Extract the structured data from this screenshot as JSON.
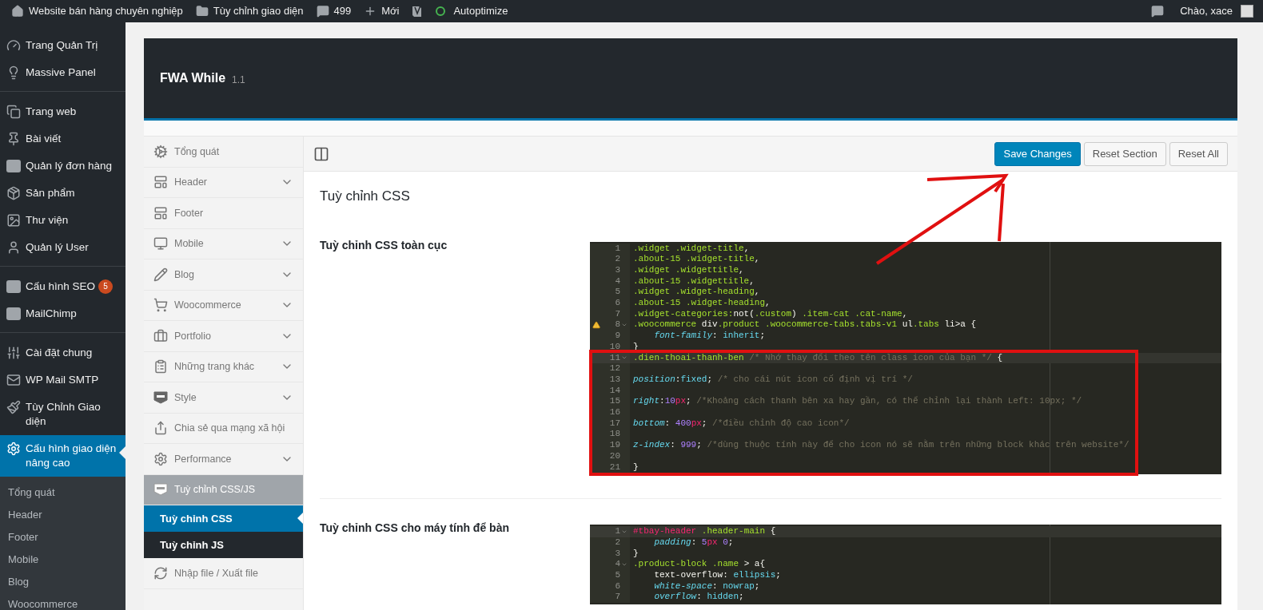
{
  "admin_bar": {
    "items": [
      {
        "label": "Website bán hàng chuyên nghiệp"
      },
      {
        "label": "Tùy chỉnh giao diện"
      },
      {
        "label": "499"
      },
      {
        "label": "Mới"
      },
      {
        "label": "Autoptimize"
      }
    ],
    "greeting": "Chào, xace"
  },
  "sidebar": {
    "groups": [
      {
        "items": [
          {
            "label": "Trang Quản Trị",
            "selected": false
          },
          {
            "label": "Massive Panel",
            "selected": false
          }
        ]
      },
      {
        "items": [
          {
            "label": "Trang web",
            "selected": false
          },
          {
            "label": "Bài viết",
            "selected": false
          },
          {
            "label": "Quản lý đơn hàng",
            "selected": false
          },
          {
            "label": "Sản phẩm",
            "selected": false
          },
          {
            "label": "Thư viện",
            "selected": false
          },
          {
            "label": "Quản lý User",
            "selected": false
          }
        ]
      },
      {
        "items": [
          {
            "label": "Cấu hình SEO",
            "selected": false,
            "badge": "5"
          },
          {
            "label": "MailChimp",
            "selected": false
          }
        ]
      },
      {
        "items": [
          {
            "label": "Cài đặt chung",
            "selected": false
          },
          {
            "label": "WP Mail SMTP",
            "selected": false
          },
          {
            "label": "Tùy Chỉnh Giao diện",
            "selected": false
          },
          {
            "label": "Cấu hình giao diện nâng cao",
            "selected": true
          }
        ]
      }
    ],
    "submenu": [
      "Tổng quát",
      "Header",
      "Footer",
      "Mobile",
      "Blog",
      "Woocommerce"
    ]
  },
  "panel": {
    "title": "FWA While",
    "version": "1.1",
    "nav": [
      {
        "label": "Tổng quát",
        "collapsible": false
      },
      {
        "label": "Header",
        "collapsible": true
      },
      {
        "label": "Footer",
        "collapsible": false
      },
      {
        "label": "Mobile",
        "collapsible": true
      },
      {
        "label": "Blog",
        "collapsible": true
      },
      {
        "label": "Woocommerce",
        "collapsible": true
      },
      {
        "label": "Portfolio",
        "collapsible": true
      },
      {
        "label": "Những trang khác",
        "collapsible": true
      },
      {
        "label": "Style",
        "collapsible": true
      },
      {
        "label": "Chia sẻ qua mạng xã hội",
        "collapsible": false
      },
      {
        "label": "Performance",
        "collapsible": true
      },
      {
        "label": "Tuỳ chỉnh CSS/JS",
        "collapsible": false,
        "expanded": true,
        "children": [
          {
            "label": "Tuỳ chỉnh CSS",
            "selected": true
          },
          {
            "label": "Tuỳ chỉnh JS",
            "selected": false
          }
        ]
      },
      {
        "label": "Nhập file / Xuất file",
        "collapsible": false
      }
    ],
    "buttons": [
      {
        "label": "Save Changes",
        "kind": "primary"
      },
      {
        "label": "Reset Section",
        "kind": "secondary"
      },
      {
        "label": "Reset All",
        "kind": "secondary"
      }
    ],
    "section_title": "Tuỳ chỉnh CSS",
    "fields": [
      {
        "label": "Tuỳ chỉnh CSS toàn cục",
        "editor": {
          "lines": [
            {
              "n": "1",
              "tokens": [
                {
                  "t": ".widget .widget-title",
                  "kind": "sel"
                },
                {
                  "t": ",",
                  "kind": "p"
                }
              ]
            },
            {
              "n": "2",
              "tokens": [
                {
                  "t": ".about-15 .widget-title",
                  "kind": "sel"
                },
                {
                  "t": ",",
                  "kind": "p"
                }
              ]
            },
            {
              "n": "3",
              "tokens": [
                {
                  "t": ".widget .widgettitle",
                  "kind": "sel"
                },
                {
                  "t": ",",
                  "kind": "p"
                }
              ]
            },
            {
              "n": "4",
              "tokens": [
                {
                  "t": ".about-15 .widgettitle",
                  "kind": "sel"
                },
                {
                  "t": ",",
                  "kind": "p"
                }
              ]
            },
            {
              "n": "5",
              "tokens": [
                {
                  "t": ".widget .widget-heading",
                  "kind": "sel"
                },
                {
                  "t": ",",
                  "kind": "p"
                }
              ]
            },
            {
              "n": "6",
              "tokens": [
                {
                  "t": ".about-15 .widget-heading",
                  "kind": "sel"
                },
                {
                  "t": ",",
                  "kind": "p"
                }
              ]
            },
            {
              "n": "7",
              "tokens": [
                {
                  "t": ".widget-categories:",
                  "kind": "sel"
                },
                {
                  "t": "not(",
                  "kind": "p"
                },
                {
                  "t": ".custom",
                  "kind": "sel"
                },
                {
                  "t": ") ",
                  "kind": "p"
                },
                {
                  "t": ".item-cat .cat-name",
                  "kind": "sel"
                },
                {
                  "t": ",",
                  "kind": "p"
                }
              ]
            },
            {
              "n": "8",
              "warning": true,
              "fold": true,
              "tokens": [
                {
                  "t": ".woocommerce",
                  "kind": "sel"
                },
                {
                  "t": " div",
                  "kind": "p"
                },
                {
                  "t": ".product .woocommerce-tabs.tabs-v1",
                  "kind": "sel"
                },
                {
                  "t": " ul",
                  "kind": "p"
                },
                {
                  "t": ".tabs",
                  "kind": "sel"
                },
                {
                  "t": " li>a {",
                  "kind": "p"
                }
              ]
            },
            {
              "n": "9",
              "tokens": [
                {
                  "t": "    font-family",
                  "kind": "prop"
                },
                {
                  "t": ": ",
                  "kind": "p"
                },
                {
                  "t": "inherit",
                  "kind": "val"
                },
                {
                  "t": ";",
                  "kind": "p"
                }
              ]
            },
            {
              "n": "10",
              "tokens": [
                {
                  "t": "}",
                  "kind": "p"
                }
              ]
            },
            {
              "n": "11",
              "fold": true,
              "active": true,
              "tokens": [
                {
                  "t": ".dien-thoai-thanh-ben",
                  "kind": "sel"
                },
                {
                  "t": " /* Nhớ thay đổi theo tên class icon của bạn */",
                  "kind": "com"
                },
                {
                  "t": " {",
                  "kind": "p"
                }
              ]
            },
            {
              "n": "12"
            },
            {
              "n": "13",
              "tokens": [
                {
                  "t": "position",
                  "kind": "prop"
                },
                {
                  "t": ":",
                  "kind": "p"
                },
                {
                  "t": "fixed",
                  "kind": "val"
                },
                {
                  "t": ";",
                  "kind": "p"
                },
                {
                  "t": " /* cho cái nút icon cố định vị trí */",
                  "kind": "com"
                }
              ]
            },
            {
              "n": "14"
            },
            {
              "n": "15",
              "tokens": [
                {
                  "t": "right",
                  "kind": "prop"
                },
                {
                  "t": ":",
                  "kind": "p"
                },
                {
                  "t": "10",
                  "kind": "num"
                },
                {
                  "t": "px",
                  "kind": "unit"
                },
                {
                  "t": ";",
                  "kind": "p"
                },
                {
                  "t": " /*Khoảng cách thanh bên xa hay gần, có thể chỉnh lại thành Left: 10px; */",
                  "kind": "com"
                }
              ]
            },
            {
              "n": "16"
            },
            {
              "n": "17",
              "tokens": [
                {
                  "t": "bottom",
                  "kind": "prop"
                },
                {
                  "t": ": ",
                  "kind": "p"
                },
                {
                  "t": "400",
                  "kind": "num"
                },
                {
                  "t": "px",
                  "kind": "unit"
                },
                {
                  "t": ";",
                  "kind": "p"
                },
                {
                  "t": " /*điều chỉnh độ cao icon*/",
                  "kind": "com"
                }
              ]
            },
            {
              "n": "18"
            },
            {
              "n": "19",
              "tokens": [
                {
                  "t": "z-index",
                  "kind": "prop"
                },
                {
                  "t": ": ",
                  "kind": "p"
                },
                {
                  "t": "999",
                  "kind": "num"
                },
                {
                  "t": ";",
                  "kind": "p"
                },
                {
                  "t": " /*dùng thuộc tính này để cho icon nó sẽ nằm trên những block khác trên website*/",
                  "kind": "com"
                }
              ]
            },
            {
              "n": "20"
            },
            {
              "n": "21",
              "tokens": [
                {
                  "t": "}",
                  "kind": "p"
                }
              ]
            }
          ]
        }
      },
      {
        "label": "Tuỳ chỉnh CSS cho máy tính để bàn",
        "editor": {
          "lines": [
            {
              "n": "1",
              "fold": true,
              "active": true,
              "tokens": [
                {
                  "t": "#tbay-header",
                  "kind": "id"
                },
                {
                  "t": " .header-main",
                  "kind": "sel"
                },
                {
                  "t": " {",
                  "kind": "p"
                }
              ]
            },
            {
              "n": "2",
              "tokens": [
                {
                  "t": "    padding",
                  "kind": "prop"
                },
                {
                  "t": ": ",
                  "kind": "p"
                },
                {
                  "t": "5",
                  "kind": "num"
                },
                {
                  "t": "px",
                  "kind": "unit"
                },
                {
                  "t": " 0",
                  "kind": "num"
                },
                {
                  "t": ";",
                  "kind": "p"
                }
              ]
            },
            {
              "n": "3",
              "tokens": [
                {
                  "t": "}",
                  "kind": "p"
                }
              ]
            },
            {
              "n": "4",
              "fold": true,
              "tokens": [
                {
                  "t": ".product-block .name",
                  "kind": "sel"
                },
                {
                  "t": " > a{",
                  "kind": "p"
                }
              ]
            },
            {
              "n": "5",
              "tokens": [
                {
                  "t": "    text-overflow: ",
                  "kind": "p"
                },
                {
                  "t": "ellipsis",
                  "kind": "val"
                },
                {
                  "t": ";",
                  "kind": "p"
                }
              ]
            },
            {
              "n": "6",
              "tokens": [
                {
                  "t": "    white-space",
                  "kind": "prop"
                },
                {
                  "t": ": ",
                  "kind": "p"
                },
                {
                  "t": "nowrap",
                  "kind": "val"
                },
                {
                  "t": ";",
                  "kind": "p"
                }
              ]
            },
            {
              "n": "7",
              "tokens": [
                {
                  "t": "    overflow",
                  "kind": "prop"
                },
                {
                  "t": ": ",
                  "kind": "p"
                },
                {
                  "t": "hidden",
                  "kind": "val"
                },
                {
                  "t": ";",
                  "kind": "p"
                }
              ]
            }
          ]
        }
      }
    ]
  }
}
